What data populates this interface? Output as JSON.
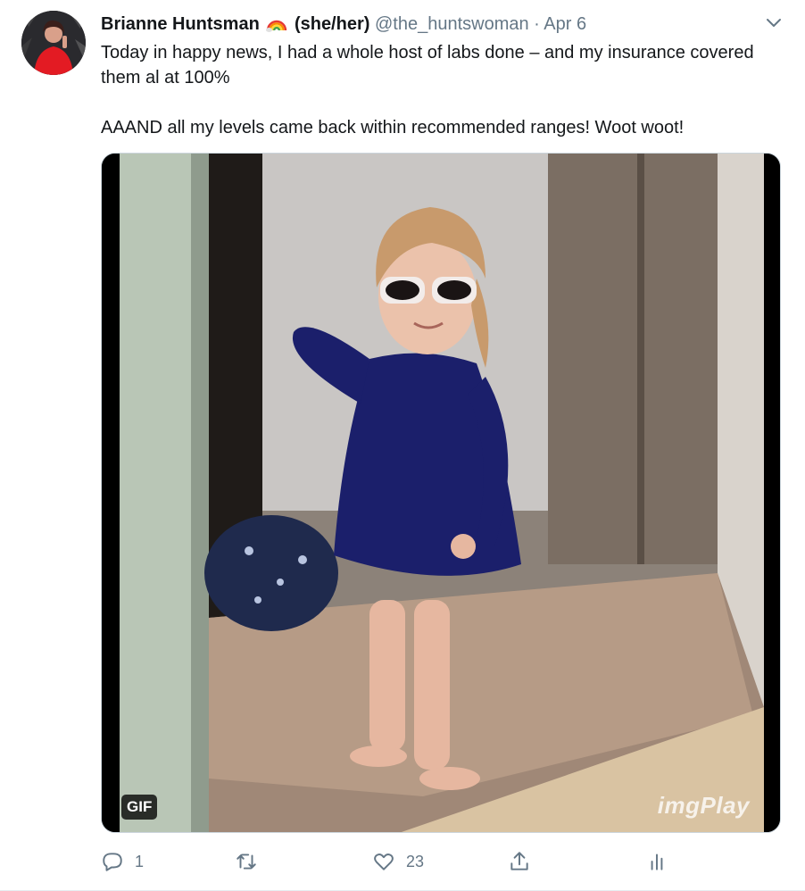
{
  "author": {
    "name": "Brianne Huntsman",
    "pronouns": "(she/her)",
    "handle": "@the_huntswoman",
    "separator": "·",
    "date": "Apr 6",
    "emoji_icon": "rainbow-icon"
  },
  "tweet": {
    "paragraphs": [
      "Today in happy news, I had a whole host of labs done – and my insurance covered them al at 100%",
      "AAAND all my levels came back within recommended ranges!  Woot woot!"
    ]
  },
  "media": {
    "badge": "GIF",
    "watermark": "imgPlay",
    "subject": "toddler in sunglasses and navy dress dancing"
  },
  "actions": {
    "reply": {
      "icon": "reply-icon",
      "count": "1"
    },
    "retweet": {
      "icon": "retweet-icon",
      "count": ""
    },
    "like": {
      "icon": "heart-icon",
      "count": "23"
    },
    "share": {
      "icon": "share-icon",
      "count": ""
    },
    "analytics": {
      "icon": "analytics-icon",
      "count": ""
    }
  },
  "colors": {
    "text": "#14171a",
    "secondary": "#657786",
    "border": "#e6ecf0"
  }
}
